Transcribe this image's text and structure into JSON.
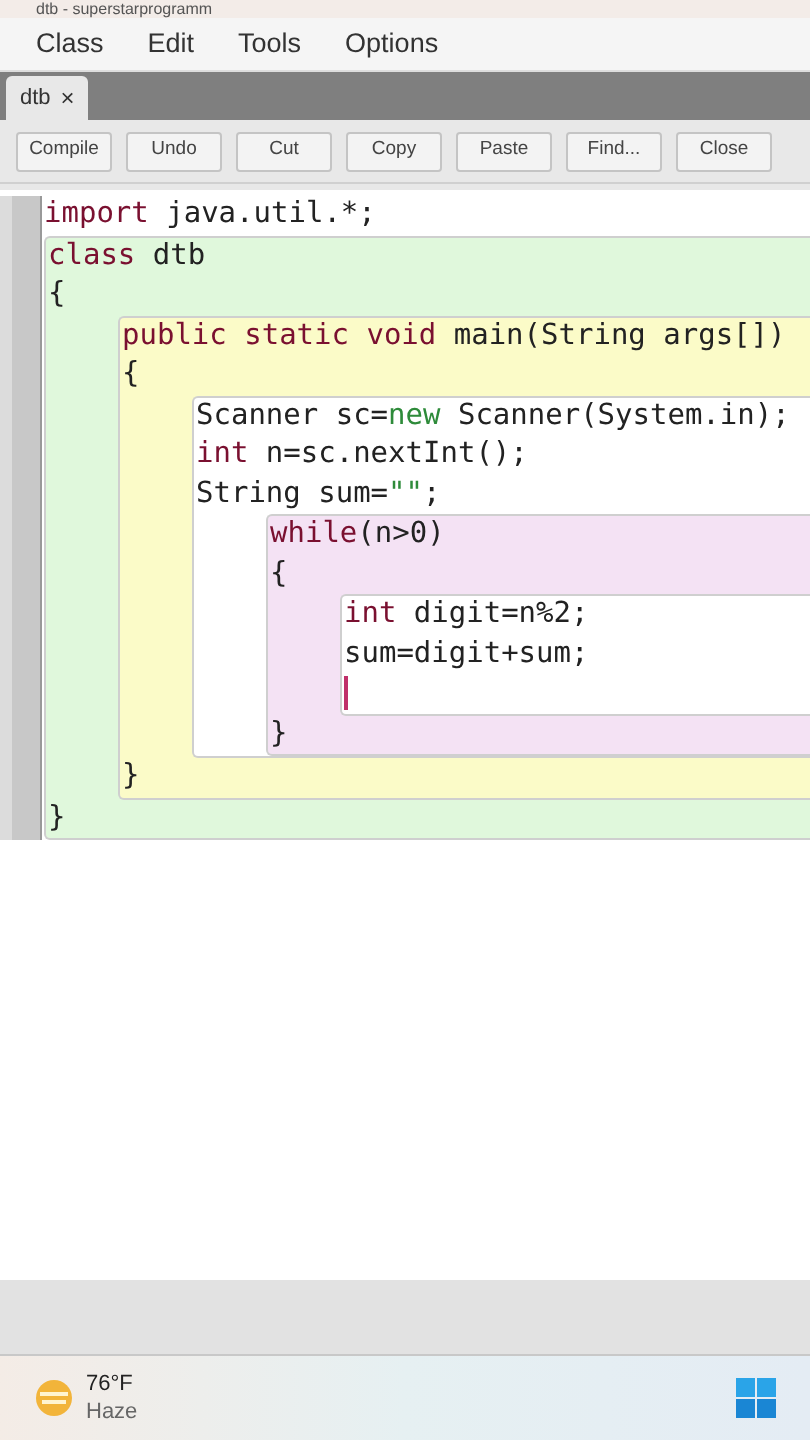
{
  "window": {
    "title": "dtb - superstarprogramm"
  },
  "menu": [
    "Class",
    "Edit",
    "Tools",
    "Options"
  ],
  "tabs": [
    {
      "label": "dtb",
      "close": "×",
      "selected": true
    }
  ],
  "toolbar": [
    "Compile",
    "Undo",
    "Cut",
    "Copy",
    "Paste",
    "Find...",
    "Close"
  ],
  "code": [
    {
      "kind": "line",
      "tokens": [
        {
          "t": "import",
          "kind": "keyword"
        },
        {
          "t": " java.util.*;",
          "kind": "plain"
        }
      ]
    },
    {
      "kind": "scope",
      "color": "#e0f8dc",
      "children": [
        {
          "kind": "line",
          "tokens": [
            {
              "t": "class",
              "kind": "keyword"
            },
            {
              "t": " dtb",
              "kind": "plain"
            }
          ]
        },
        {
          "kind": "line",
          "tokens": [
            {
              "t": "{",
              "kind": "plain"
            }
          ]
        },
        {
          "kind": "scope",
          "color": "#fbfbc8",
          "children": [
            {
              "kind": "line",
              "tokens": [
                {
                  "t": "public static void",
                  "kind": "keyword"
                },
                {
                  "t": " main(String args[])",
                  "kind": "plain"
                }
              ]
            },
            {
              "kind": "line",
              "tokens": [
                {
                  "t": "{",
                  "kind": "plain"
                }
              ]
            },
            {
              "kind": "scope",
              "color": "#ffffff",
              "children": [
                {
                  "kind": "line",
                  "tokens": [
                    {
                      "t": "Scanner sc=",
                      "kind": "plain"
                    },
                    {
                      "t": "new",
                      "kind": "literal"
                    },
                    {
                      "t": " Scanner(System.in);",
                      "kind": "plain"
                    }
                  ]
                },
                {
                  "kind": "line",
                  "tokens": [
                    {
                      "t": "int",
                      "kind": "keyword"
                    },
                    {
                      "t": " n=sc.nextInt();",
                      "kind": "plain"
                    }
                  ]
                },
                {
                  "kind": "line",
                  "tokens": [
                    {
                      "t": "String sum=",
                      "kind": "plain"
                    },
                    {
                      "t": "\"\"",
                      "kind": "literal"
                    },
                    {
                      "t": ";",
                      "kind": "plain"
                    }
                  ]
                },
                {
                  "kind": "scope",
                  "color": "#f4e2f4",
                  "children": [
                    {
                      "kind": "line",
                      "tokens": [
                        {
                          "t": "while",
                          "kind": "keyword"
                        },
                        {
                          "t": "(n>0)",
                          "kind": "plain"
                        }
                      ]
                    },
                    {
                      "kind": "line",
                      "tokens": [
                        {
                          "t": "{",
                          "kind": "plain"
                        }
                      ]
                    },
                    {
                      "kind": "scope",
                      "color": "#ffffff",
                      "children": [
                        {
                          "kind": "line",
                          "tokens": [
                            {
                              "t": "int",
                              "kind": "keyword"
                            },
                            {
                              "t": " digit=n%2;",
                              "kind": "plain"
                            }
                          ]
                        },
                        {
                          "kind": "line",
                          "tokens": [
                            {
                              "t": "sum=digit+sum;",
                              "kind": "plain"
                            }
                          ]
                        },
                        {
                          "kind": "line",
                          "cursor": true
                        }
                      ]
                    },
                    {
                      "kind": "line",
                      "tokens": [
                        {
                          "t": "}",
                          "kind": "plain"
                        }
                      ]
                    }
                  ]
                }
              ]
            },
            {
              "kind": "line",
              "tokens": [
                {
                  "t": "}",
                  "kind": "plain"
                }
              ]
            }
          ]
        },
        {
          "kind": "line",
          "tokens": [
            {
              "t": "}",
              "kind": "plain"
            }
          ]
        }
      ]
    }
  ],
  "taskbar": {
    "temperature": "76°F",
    "condition": "Haze"
  }
}
